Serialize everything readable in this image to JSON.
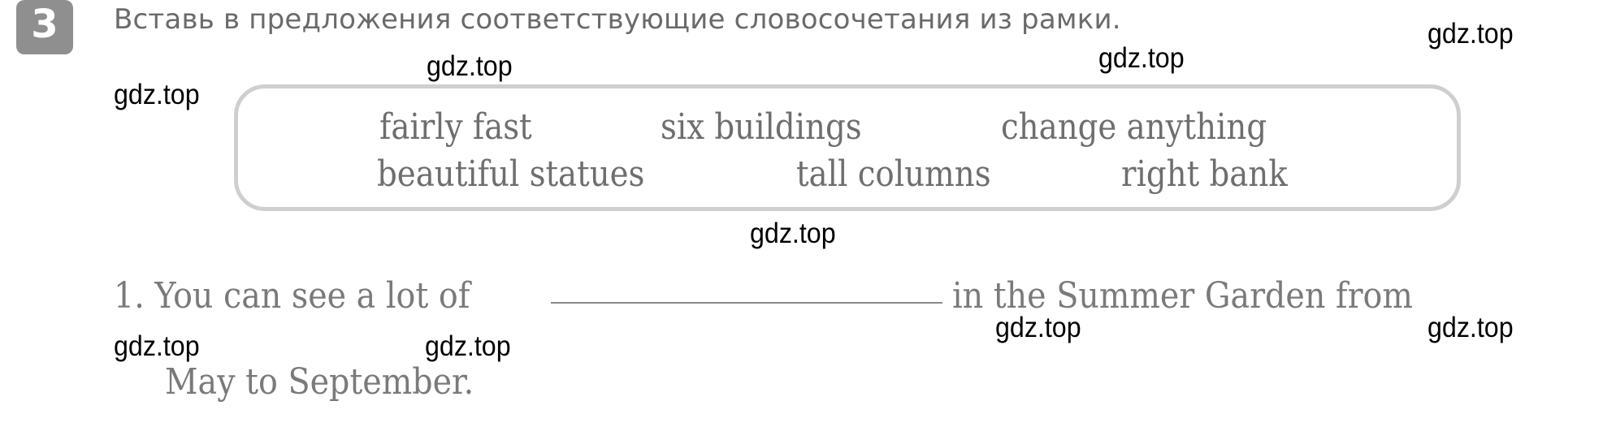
{
  "exercise": {
    "number": "3",
    "instruction": "Вставь в предложения соответствующие словосочетания из рамки."
  },
  "word_box": {
    "row1": [
      "fairly fast",
      "six buildings",
      "change anything"
    ],
    "row2": [
      "beautiful statues",
      "tall columns",
      "right bank"
    ]
  },
  "sentences": [
    {
      "number": "1.",
      "before_blank": "You can see a lot of",
      "answer": "",
      "after_blank": "in the Summer Garden from",
      "continuation": "May to September."
    }
  ],
  "watermark": {
    "text": "gdz.top"
  }
}
